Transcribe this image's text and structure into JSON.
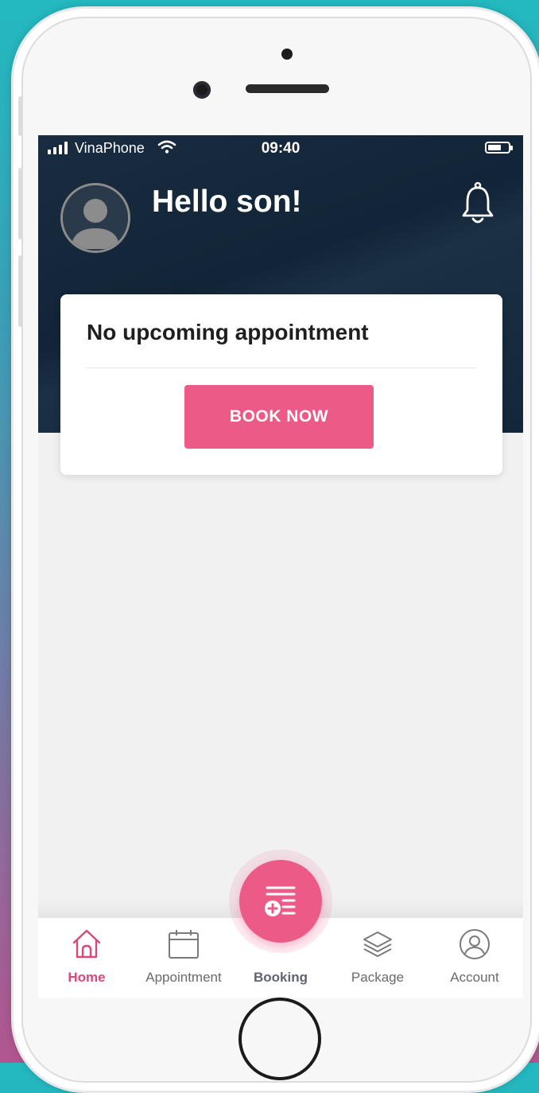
{
  "status_bar": {
    "carrier": "VinaPhone",
    "time": "09:40",
    "icons": [
      "signal-icon",
      "wifi-icon",
      "battery-icon"
    ]
  },
  "header": {
    "greeting": "Hello son!",
    "avatar_icon": "user-avatar-icon",
    "notification_icon": "bell-icon"
  },
  "appointment_card": {
    "title": "No upcoming appointment",
    "button_label": "BOOK NOW"
  },
  "fab": {
    "icon": "add-booking-icon"
  },
  "bottom_nav": {
    "items": [
      {
        "label": "Home",
        "icon": "home-icon",
        "active": true
      },
      {
        "label": "Appointment",
        "icon": "calendar-icon",
        "active": false
      },
      {
        "label": "Booking",
        "icon": "add-booking-icon",
        "active": false
      },
      {
        "label": "Package",
        "icon": "layers-icon",
        "active": false
      },
      {
        "label": "Account",
        "icon": "account-icon",
        "active": false
      }
    ]
  },
  "colors": {
    "accent": "#ec5a88",
    "header_bg": "#14263a",
    "screen_bg": "#f1f1f2",
    "nav_active": "#d8487a"
  }
}
